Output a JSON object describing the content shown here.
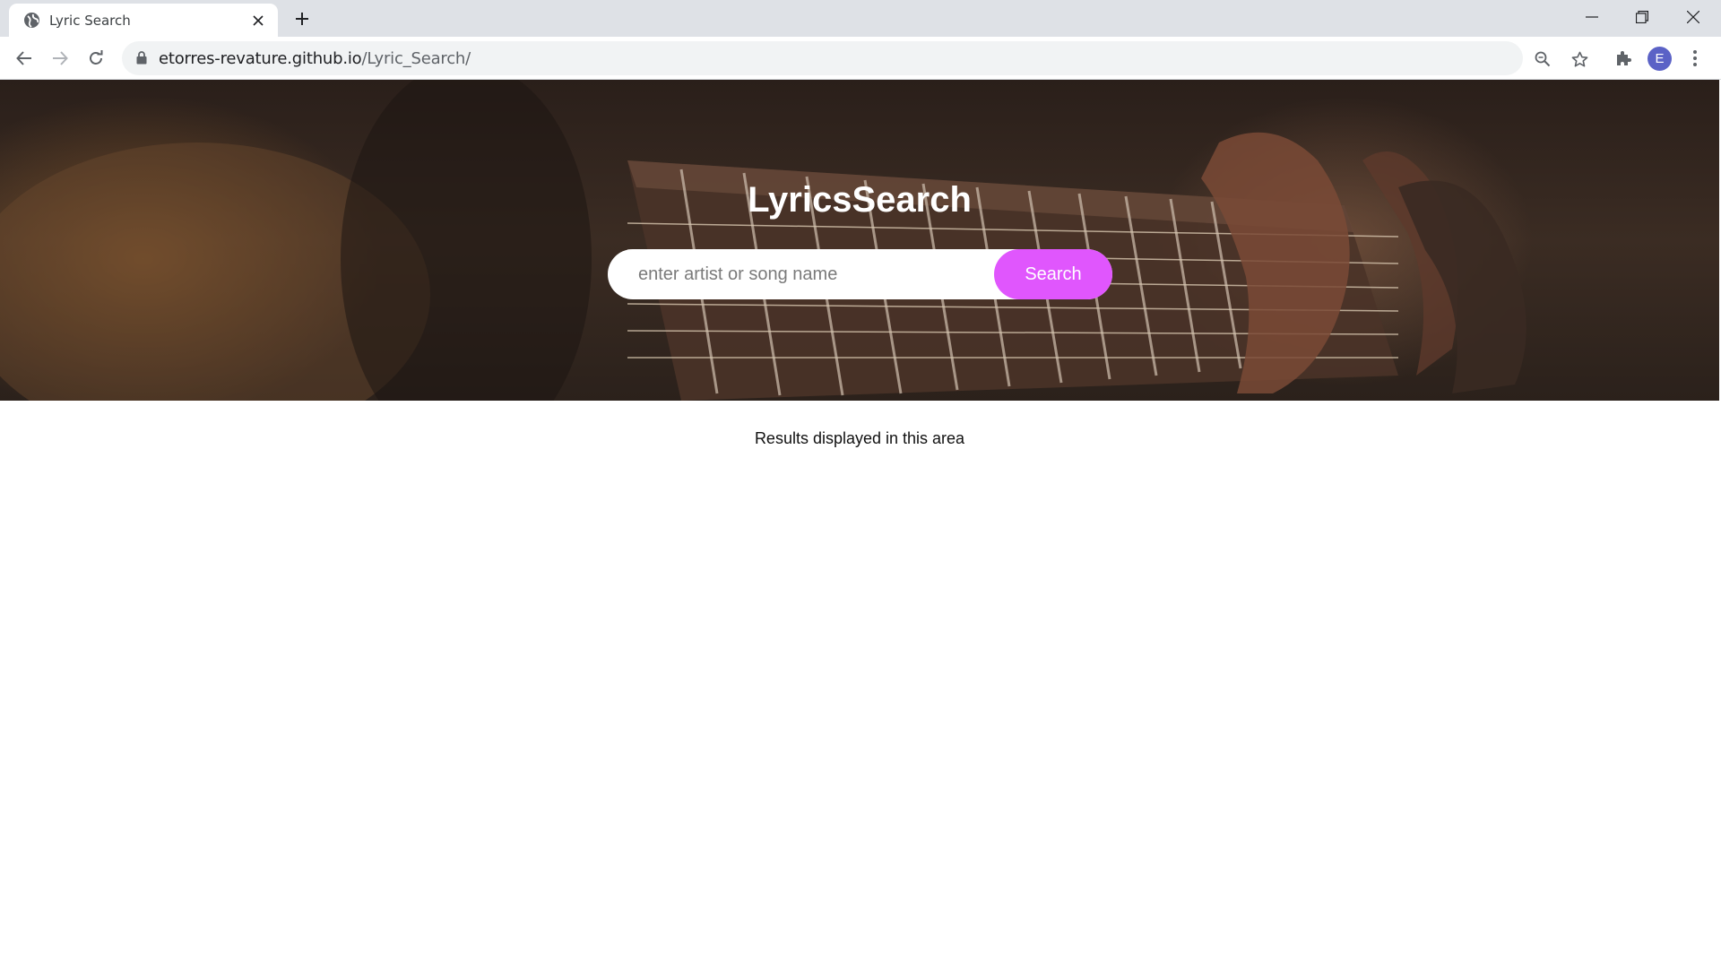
{
  "browser": {
    "tab_title": "Lyric Search",
    "url_host": "etorres-revature.github.io",
    "url_path": "/Lyric_Search/",
    "profile_initial": "E",
    "icons": [
      "globe-icon",
      "close-icon",
      "plus-icon",
      "minimize-icon",
      "restore-icon",
      "close-window-icon",
      "back-icon",
      "forward-icon",
      "reload-icon",
      "lock-icon",
      "zoom-icon",
      "star-icon",
      "extensions-icon",
      "menu-icon"
    ]
  },
  "page": {
    "title": "LyricsSearch",
    "search": {
      "placeholder": "enter artist or song name",
      "value": "",
      "button_label": "Search"
    },
    "results_text": "Results displayed in this area",
    "colors": {
      "accent": "#e056fd",
      "hero_dark": "#2a1f1a"
    }
  }
}
